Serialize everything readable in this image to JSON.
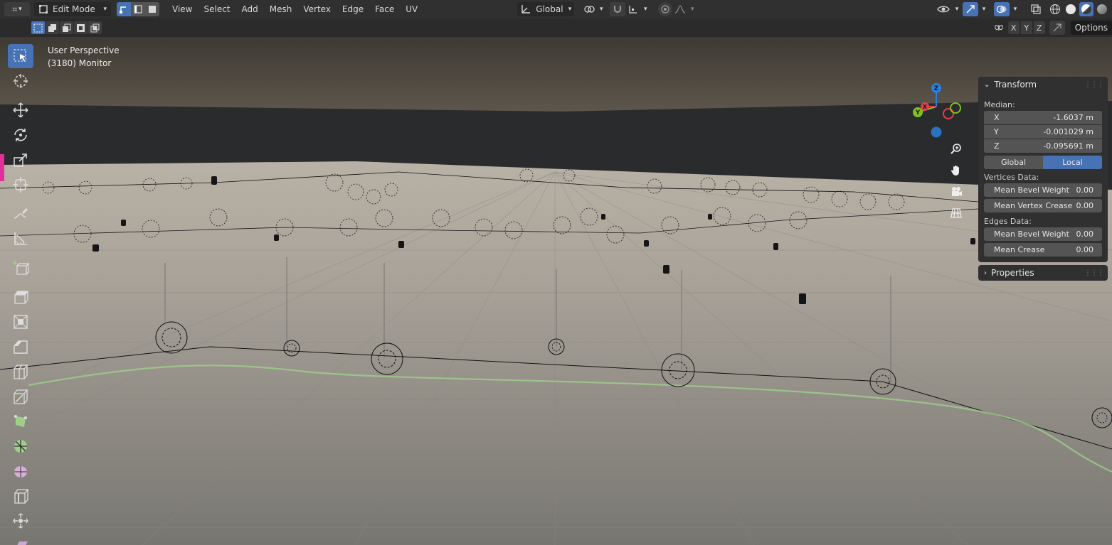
{
  "header": {
    "mode": "Edit Mode",
    "menus": [
      "View",
      "Select",
      "Add",
      "Mesh",
      "Vertex",
      "Edge",
      "Face",
      "UV"
    ],
    "orientation": "Global"
  },
  "subheader": {
    "axes": [
      "X",
      "Y",
      "Z"
    ],
    "options_label": "Options"
  },
  "viewport": {
    "view_name": "User Perspective",
    "object_info": "(3180) Monitor"
  },
  "gizmo": {
    "z_label": "Z",
    "y_label": "Y",
    "x_label": "X"
  },
  "npanel": {
    "transform": {
      "title": "Transform",
      "median_label": "Median:",
      "x": {
        "label": "X",
        "value": "-1.6037 m"
      },
      "y": {
        "label": "Y",
        "value": "-0.001029 m"
      },
      "z": {
        "label": "Z",
        "value": "-0.095691 m"
      },
      "global_label": "Global",
      "local_label": "Local",
      "vertices_label": "Vertices Data:",
      "mean_bevel_weight_v": {
        "label": "Mean Bevel Weight",
        "value": "0.00"
      },
      "mean_vertex_crease": {
        "label": "Mean Vertex Crease",
        "value": "0.00"
      },
      "edges_label": "Edges Data:",
      "mean_bevel_weight_e": {
        "label": "Mean Bevel Weight",
        "value": "0.00"
      },
      "mean_crease": {
        "label": "Mean Crease",
        "value": "0.00"
      }
    },
    "properties": {
      "title": "Properties"
    }
  },
  "colors": {
    "accent": "#4772b3",
    "header_bg": "#303030",
    "panel_bg": "#303030",
    "field_bg": "#545454",
    "axis_x": "#e0404f",
    "axis_y": "#80c020",
    "axis_z": "#2d7fdc"
  }
}
